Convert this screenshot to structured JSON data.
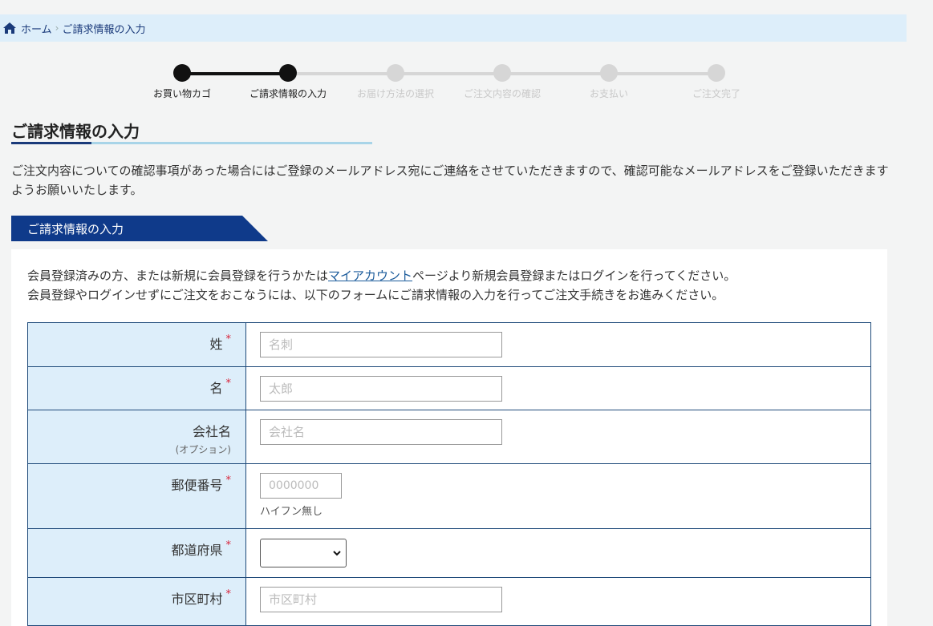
{
  "breadcrumb": {
    "home": "ホーム",
    "current": "ご請求情報の入力"
  },
  "steps": [
    {
      "label": "お買い物カゴ",
      "done": true
    },
    {
      "label": "ご請求情報の入力",
      "done": true
    },
    {
      "label": "お届け方法の選択",
      "done": false
    },
    {
      "label": "ご注文内容の確認",
      "done": false
    },
    {
      "label": "お支払い",
      "done": false
    },
    {
      "label": "ご注文完了",
      "done": false
    }
  ],
  "page": {
    "title": "ご請求情報の入力",
    "intro": "ご注文内容についての確認事項があった場合にはご登録のメールアドレス宛にご連絡をさせていただきますので、確認可能なメールアドレスをご登録いただきますようお願いいたします。",
    "section_title": "ご請求情報の入力"
  },
  "panel": {
    "line1_before": "会員登録済みの方、または新規に会員登録を行うかたは",
    "line1_link": "マイアカウント",
    "line1_after": "ページより新規会員登録またはログインを行ってください。",
    "line2": "会員登録やログインせずにご注文をおこなうには、以下のフォームにご請求情報の入力を行ってご注文手続きをお進みください。"
  },
  "form": {
    "required_mark": "*",
    "last_name": {
      "label": "姓",
      "placeholder": "名刺"
    },
    "first_name": {
      "label": "名",
      "placeholder": "太郎"
    },
    "company": {
      "label": "会社名",
      "optional": "(オプション)",
      "placeholder": "会社名"
    },
    "postal": {
      "label": "郵便番号",
      "placeholder": "0000000",
      "hint": "ハイフン無し"
    },
    "prefecture": {
      "label": "都道府県",
      "value": ""
    },
    "city": {
      "label": "市区町村",
      "placeholder": "市区町村"
    }
  },
  "colors": {
    "accent": "#0f3a8a",
    "table_border": "#1f4a7a",
    "label_bg": "#ddeefa",
    "required": "#d9233a"
  },
  "icons": {
    "home": "home-icon",
    "select_arrow": "chevron-down-icon"
  }
}
